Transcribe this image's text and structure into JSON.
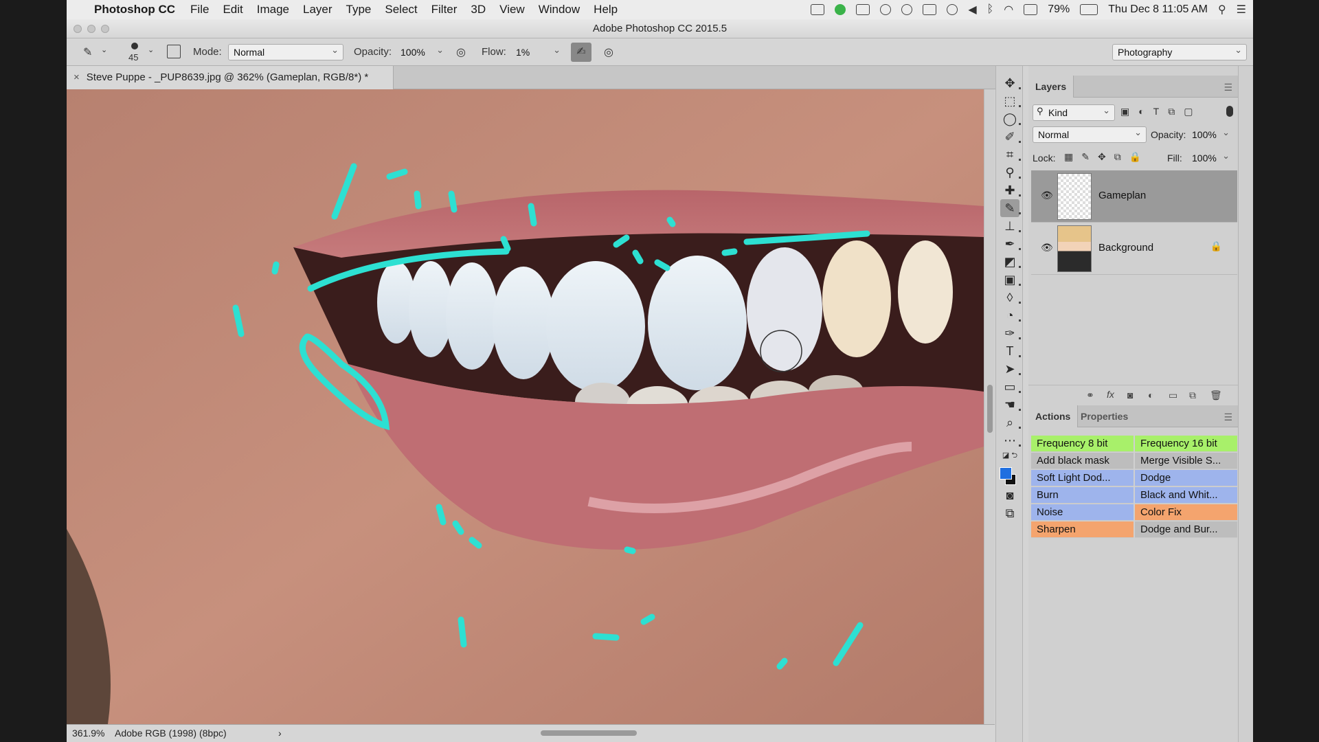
{
  "menubar": {
    "app": "Photoshop CC",
    "items": [
      "File",
      "Edit",
      "Image",
      "Layer",
      "Type",
      "Select",
      "Filter",
      "3D",
      "View",
      "Window",
      "Help"
    ],
    "battery": "79%",
    "clock": "Thu Dec 8  11:05 AM"
  },
  "window": {
    "title": "Adobe Photoshop CC 2015.5"
  },
  "options": {
    "brush_size": "45",
    "mode_label": "Mode:",
    "mode_value": "Normal",
    "opacity_label": "Opacity:",
    "opacity_value": "100%",
    "flow_label": "Flow:",
    "flow_value": "1%",
    "workspace": "Photography"
  },
  "document": {
    "tab_title": "Steve Puppe - _PUP8639.jpg @ 362% (Gameplan, RGB/8*) *",
    "zoom": "361.9%",
    "profile": "Adobe RGB (1998) (8bpc)"
  },
  "layers_panel": {
    "tab": "Layers",
    "filter": "Kind",
    "blend": "Normal",
    "opacity_label": "Opacity:",
    "opacity_value": "100%",
    "lock_label": "Lock:",
    "fill_label": "Fill:",
    "fill_value": "100%",
    "layers": [
      {
        "name": "Gameplan",
        "selected": true
      },
      {
        "name": "Background",
        "selected": false,
        "locked": true
      }
    ]
  },
  "actions_panel": {
    "tabs": [
      "Actions",
      "Properties"
    ],
    "actions": [
      {
        "label": "Frequency 8 bit",
        "color": "#a8f06a"
      },
      {
        "label": "Frequency 16 bit",
        "color": "#a8f06a"
      },
      {
        "label": "Add black mask",
        "color": "#bdbdbd"
      },
      {
        "label": "Merge Visible S...",
        "color": "#bdbdbd"
      },
      {
        "label": "Soft Light Dod...",
        "color": "#9eb4ec"
      },
      {
        "label": "Dodge",
        "color": "#9eb4ec"
      },
      {
        "label": "Burn",
        "color": "#9eb4ec"
      },
      {
        "label": "Black and Whit...",
        "color": "#9eb4ec"
      },
      {
        "label": "Noise",
        "color": "#9eb4ec"
      },
      {
        "label": "Color Fix",
        "color": "#f4a46e"
      },
      {
        "label": "Sharpen",
        "color": "#f4a46e"
      },
      {
        "label": "Dodge and Bur...",
        "color": "#bdbdbd"
      }
    ]
  },
  "colors": {
    "foreground": "#1f6fe0",
    "background": "#111111",
    "annotation": "#2de0d2"
  },
  "tools": [
    "move-icon",
    "marquee-icon",
    "lasso-icon",
    "quick-select-icon",
    "crop-icon",
    "eyedropper-icon",
    "healing-icon",
    "brush-icon",
    "stamp-icon",
    "history-brush-icon",
    "eraser-icon",
    "gradient-icon",
    "blur-icon",
    "dodge-icon",
    "pen-icon",
    "type-icon",
    "path-select-icon",
    "shape-icon",
    "hand-icon",
    "zoom-icon",
    "more-tools-icon"
  ]
}
